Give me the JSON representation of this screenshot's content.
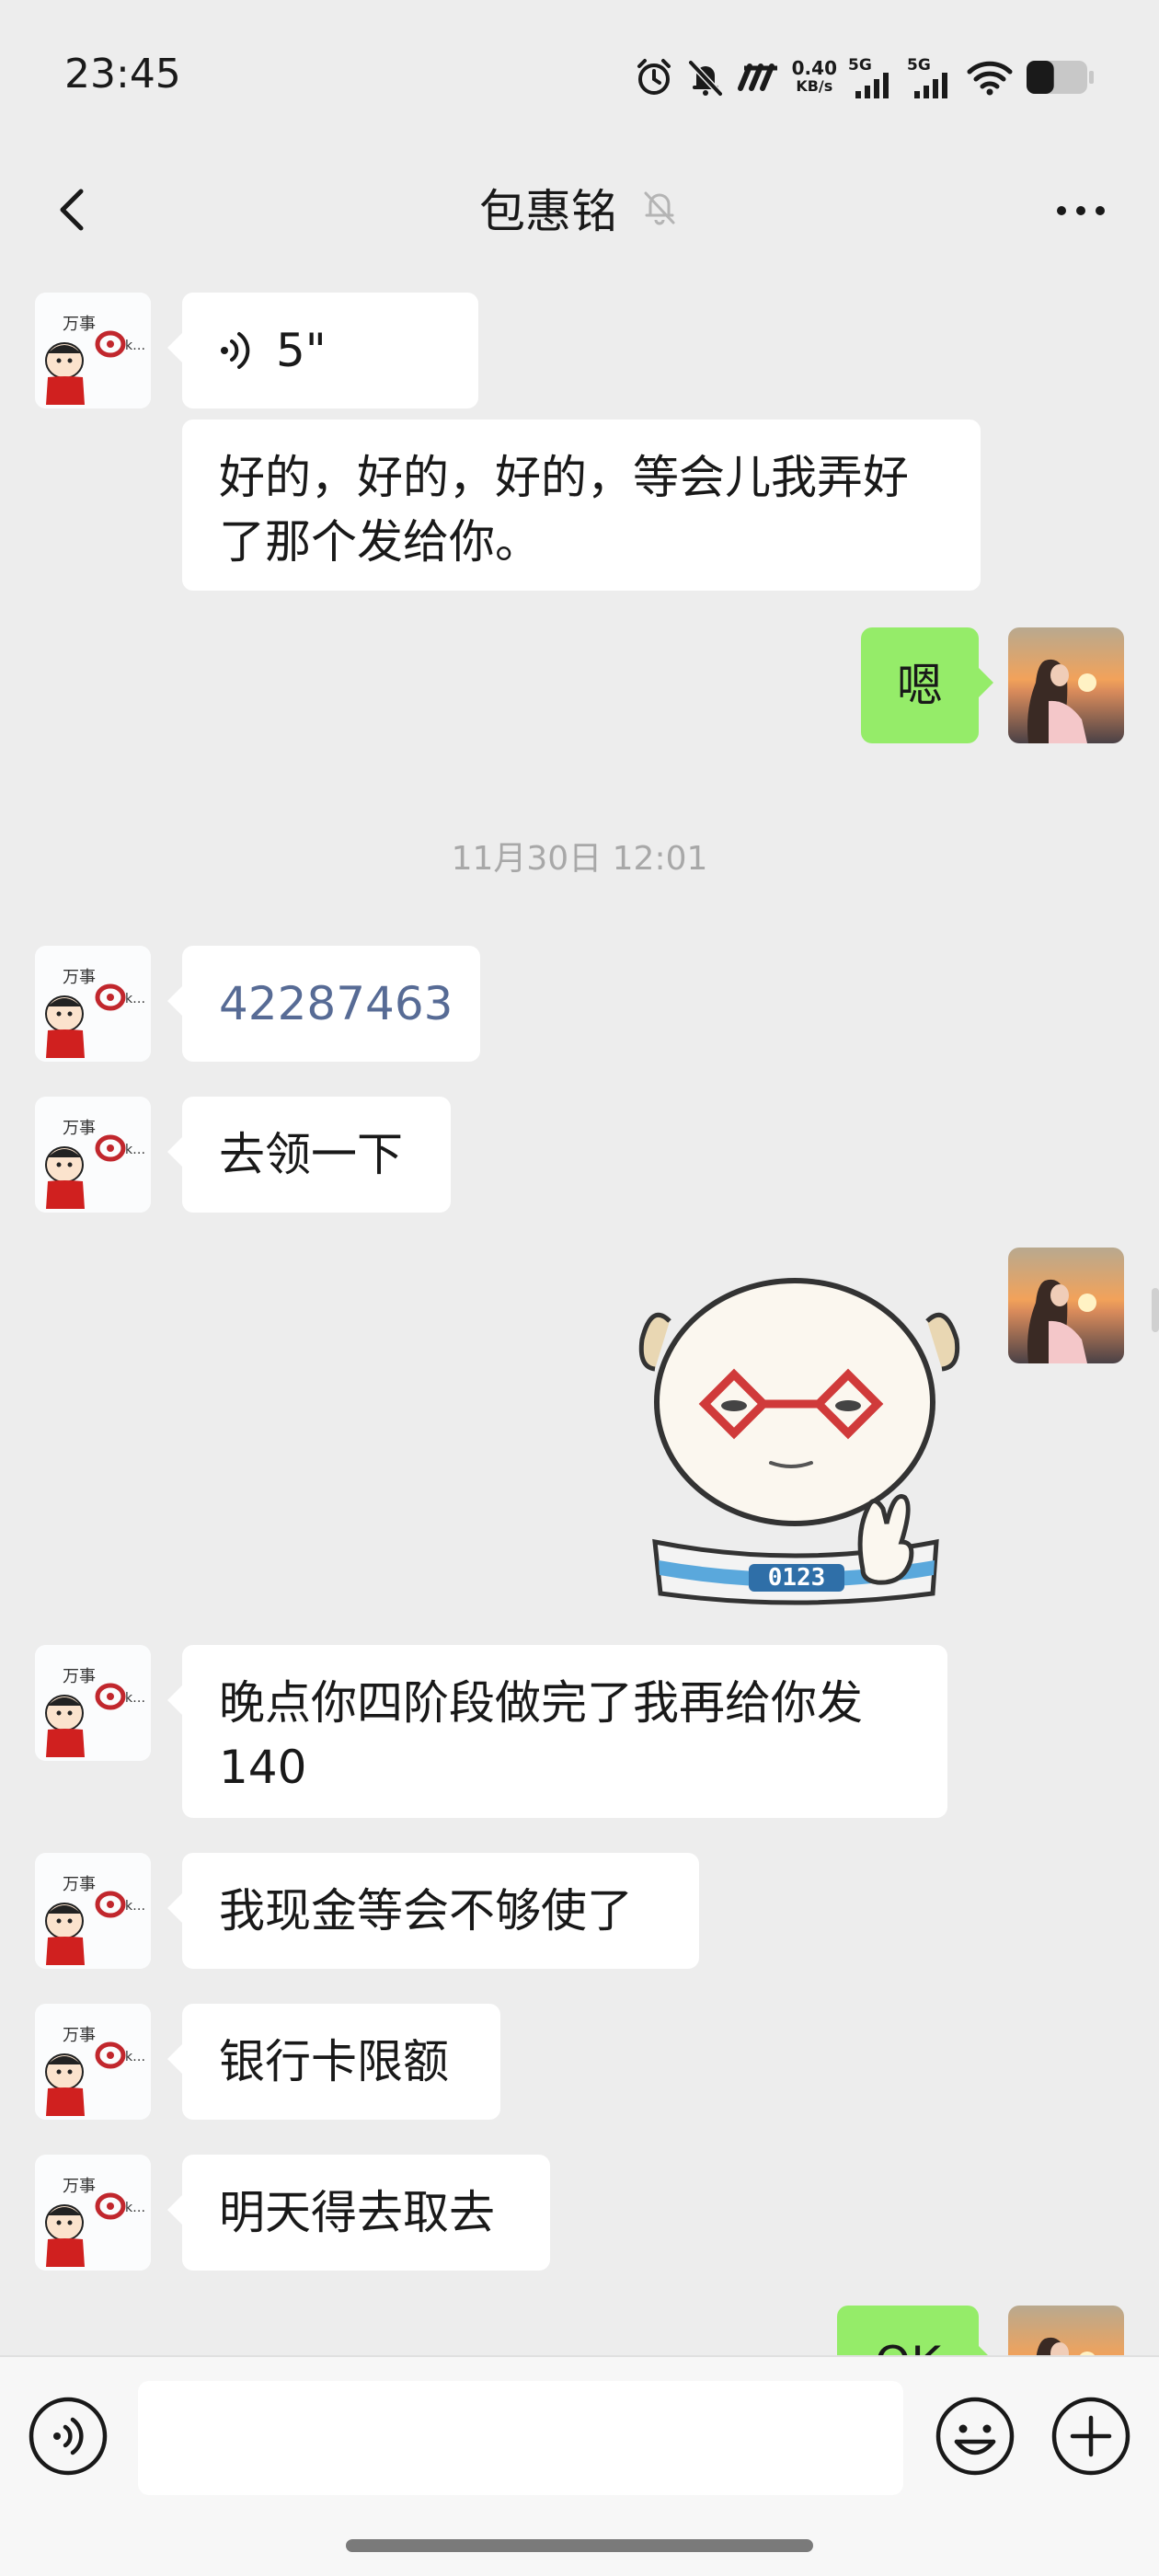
{
  "status_bar": {
    "time": "23:45",
    "network_speed": "0.40",
    "network_speed_unit": "KB/s",
    "sim1_label": "5G",
    "sim2_label": "5G",
    "battery_level": 0.45,
    "icons": [
      "alarm-icon",
      "mute-icon",
      "carrier-icon",
      "signal-icon",
      "wifi-icon",
      "battery-icon"
    ]
  },
  "header": {
    "title": "包惠铭",
    "muted": true
  },
  "messages": [
    {
      "side": "left",
      "type": "voice",
      "duration": "5\""
    },
    {
      "side": "left",
      "type": "text",
      "text": "好的，好的，好的，等会儿我弄好了那个发给你。"
    },
    {
      "side": "right",
      "type": "text",
      "text": "嗯"
    },
    {
      "type": "timestamp",
      "text": "11月30日 12:01"
    },
    {
      "side": "left",
      "type": "link",
      "text": "42287463"
    },
    {
      "side": "left",
      "type": "text",
      "text": "去领一下"
    },
    {
      "side": "right",
      "type": "sticker",
      "sticker_text": "0123"
    },
    {
      "side": "left",
      "type": "text",
      "text": "晚点你四阶段做完了我再给你发140"
    },
    {
      "side": "left",
      "type": "text",
      "text": "我现金等会不够使了"
    },
    {
      "side": "left",
      "type": "text",
      "text": "银行卡限额"
    },
    {
      "side": "left",
      "type": "text",
      "text": "明天得去取去"
    },
    {
      "side": "right",
      "type": "text",
      "text": "OK"
    }
  ],
  "input_bar": {
    "value": "",
    "placeholder": ""
  },
  "colors": {
    "background": "#ededed",
    "outgoing_bubble": "#95ec69",
    "incoming_bubble": "#ffffff",
    "link": "#576b95",
    "timestamp": "#a8a8a8"
  }
}
